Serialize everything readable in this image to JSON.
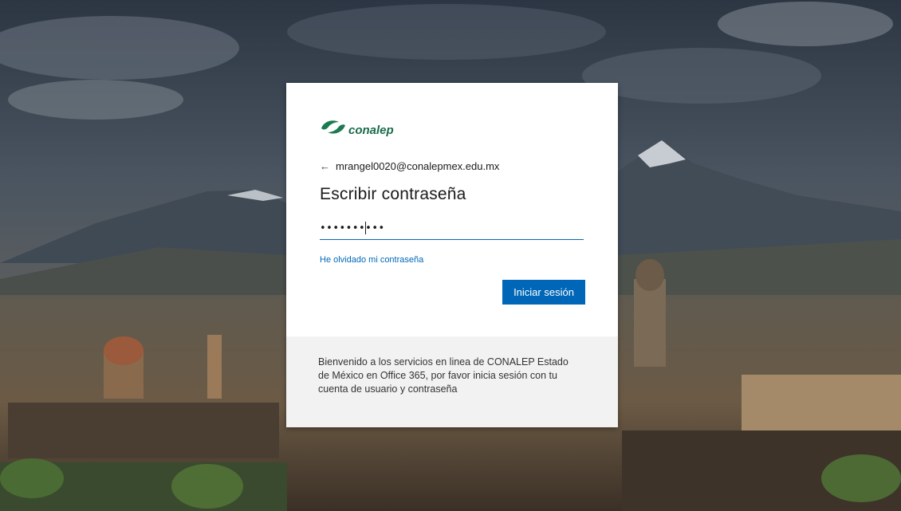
{
  "background": {
    "name": "city-landscape-background"
  },
  "brand": {
    "logo_text": "conalep",
    "color": "#1b6b4b"
  },
  "login": {
    "identity": "mrangel0020@conalepmex.edu.mx",
    "back_icon": "back-arrow-icon",
    "title": "Escribir contraseña",
    "password_value": "••••••••••",
    "forgot_link": "He olvidado mi contraseña",
    "submit_label": "Iniciar sesión",
    "accent_color": "#0067b8"
  },
  "footer": {
    "message": "Bienvenido a los servicios en linea de CONALEP Estado de México en Office 365, por favor inicia sesión con tu cuenta de usuario y contraseña"
  }
}
